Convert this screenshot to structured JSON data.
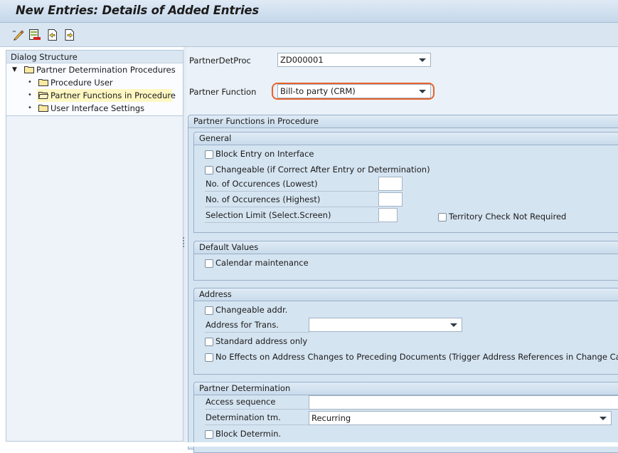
{
  "window": {
    "title": "New Entries: Details of Added Entries"
  },
  "toolbar": {
    "icons": [
      {
        "name": "change-display-icon",
        "tooltip": "Display -> Change"
      },
      {
        "name": "delete-icon",
        "tooltip": "Delete"
      },
      {
        "name": "previous-entry-icon",
        "tooltip": "Previous Entry"
      },
      {
        "name": "next-entry-icon",
        "tooltip": "Next Entry"
      }
    ]
  },
  "dialog_structure": {
    "header": "Dialog Structure",
    "items": [
      {
        "label": "Partner Determination Procedures",
        "level": 0,
        "expanded": true,
        "selected": false
      },
      {
        "label": "Procedure User",
        "level": 1,
        "selected": false
      },
      {
        "label": "Partner Functions in Procedure",
        "level": 1,
        "selected": true
      },
      {
        "label": "User Interface Settings",
        "level": 1,
        "selected": false
      }
    ]
  },
  "header_fields": {
    "proc_label": "PartnerDetProc",
    "proc_value": "ZD000001",
    "func_label": "Partner Function",
    "func_value": "Bill-to party (CRM)",
    "highlight_color": "#e8622b"
  },
  "main_group": {
    "title": "Partner Functions in Procedure",
    "general": {
      "title": "General",
      "block_entry": "Block Entry on Interface",
      "changeable": "Changeable (if Correct After Entry or Determination)",
      "occ_lowest": "No. of Occurences (Lowest)",
      "occ_lowest_value": "",
      "occ_highest": "No. of Occurences (Highest)",
      "occ_highest_value": "",
      "sel_limit": "Selection Limit (Select.Screen)",
      "sel_limit_value": "",
      "territory_check": "Territory Check Not Required"
    },
    "default_values": {
      "title": "Default Values",
      "calendar": "Calendar maintenance"
    },
    "address": {
      "title": "Address",
      "changeable_addr": "Changeable addr.",
      "addr_trans_label": "Address for Trans.",
      "addr_trans_value": "",
      "standard_only": "Standard address only",
      "no_effects": "No Effects on Address Changes to Preceding Documents (Trigger Address References in Change Case)"
    },
    "partner_determination": {
      "title": "Partner Determination",
      "access_seq_label": "Access sequence",
      "access_seq_value": "",
      "det_time_label": "Determination tm.",
      "det_time_value": "Recurring",
      "block_determin": "Block Determin."
    }
  }
}
